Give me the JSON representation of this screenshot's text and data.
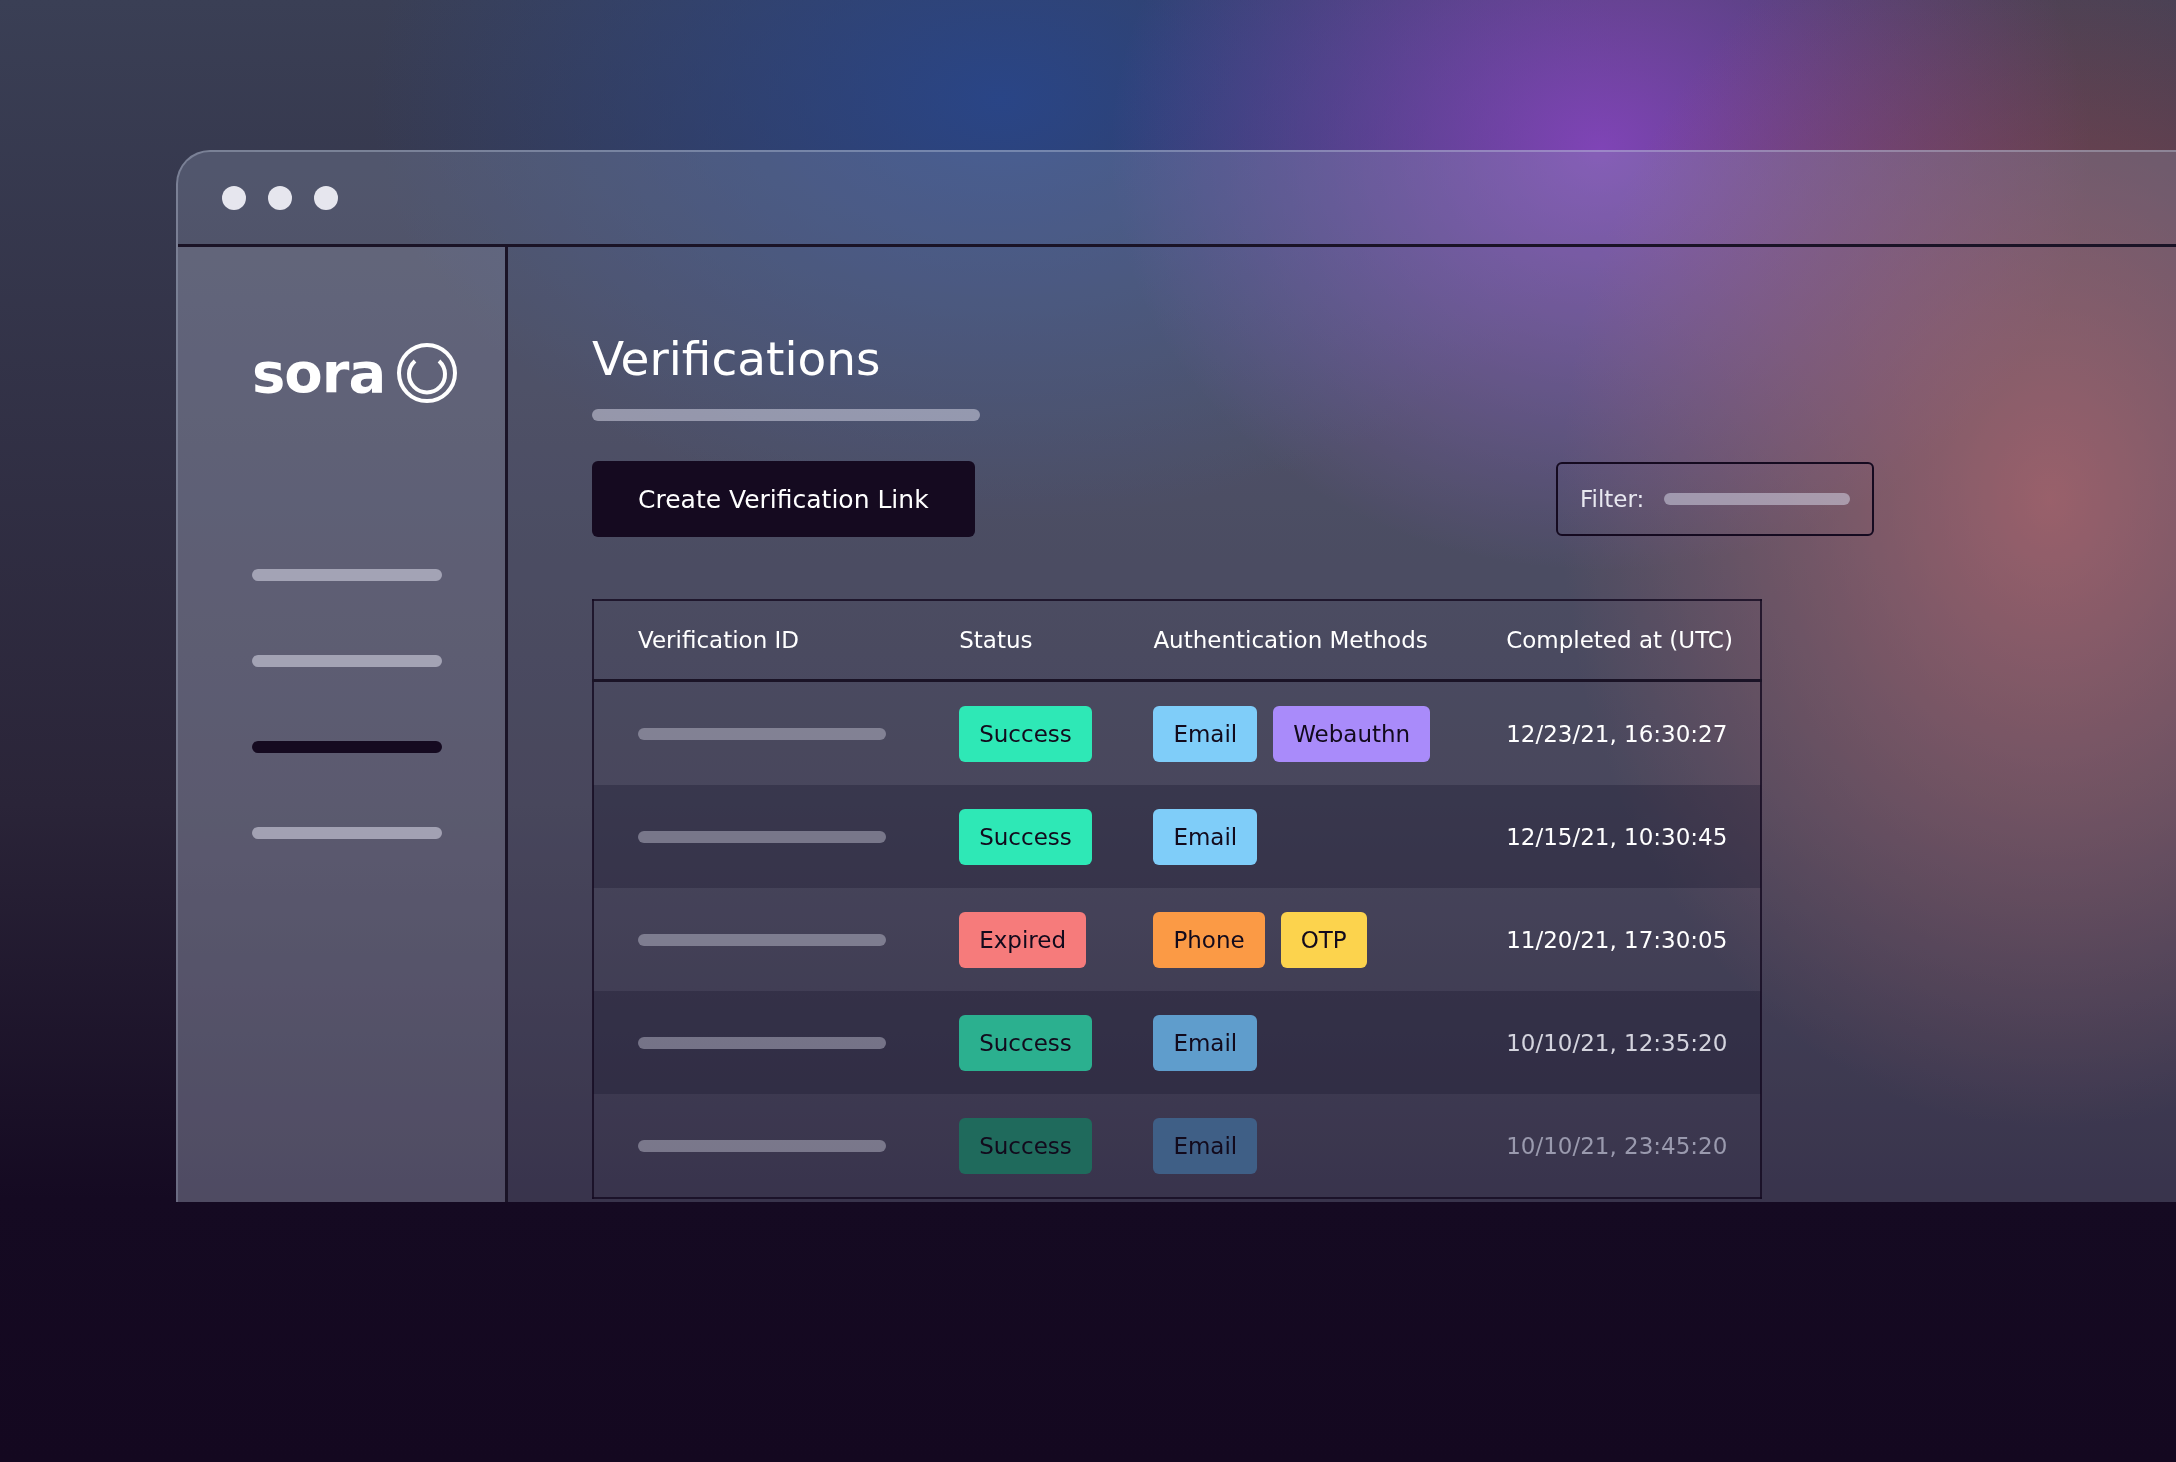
{
  "logo": {
    "text": "sora"
  },
  "sidebar": {
    "items": [
      {
        "selected": false
      },
      {
        "selected": false
      },
      {
        "selected": true
      },
      {
        "selected": false
      }
    ]
  },
  "page": {
    "title": "Verifications",
    "primary_button": "Create Verification Link",
    "filter": {
      "label": "Filter:"
    }
  },
  "table": {
    "columns": [
      "Verification ID",
      "Status",
      "Authentication Methods",
      "Completed at (UTC)"
    ],
    "rows": [
      {
        "status": {
          "label": "Success",
          "color": "#2ee8b6"
        },
        "methods": [
          {
            "label": "Email",
            "color": "#7fcdf9"
          },
          {
            "label": "Webauthn",
            "color": "#a98bfa"
          }
        ],
        "completed": "12/23/21, 16:30:27"
      },
      {
        "status": {
          "label": "Success",
          "color": "#2ee8b6"
        },
        "methods": [
          {
            "label": "Email",
            "color": "#7fcdf9"
          }
        ],
        "completed": "12/15/21, 10:30:45"
      },
      {
        "status": {
          "label": "Expired",
          "color": "#f67b7b"
        },
        "methods": [
          {
            "label": "Phone",
            "color": "#fb9a45"
          },
          {
            "label": "OTP",
            "color": "#fcd34d"
          }
        ],
        "completed": "11/20/21, 17:30:05"
      },
      {
        "status": {
          "label": "Success",
          "color": "#2bb08f"
        },
        "methods": [
          {
            "label": "Email",
            "color": "#5f9dcc"
          }
        ],
        "completed": "10/10/21, 12:35:20"
      },
      {
        "status": {
          "label": "Success",
          "color": "#1f6a5c"
        },
        "methods": [
          {
            "label": "Email",
            "color": "#3f5f86"
          }
        ],
        "completed": "10/10/21, 23:45:20"
      }
    ]
  }
}
